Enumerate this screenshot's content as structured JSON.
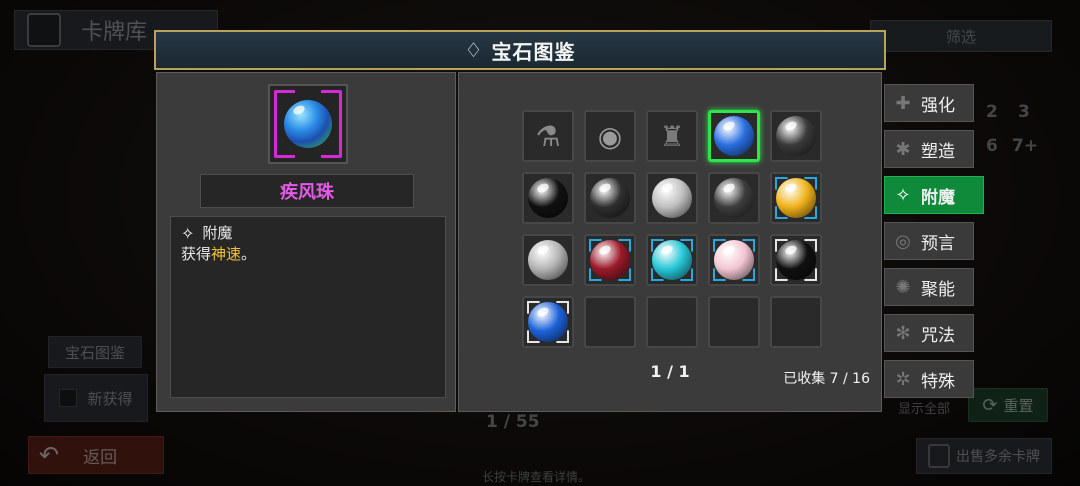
{
  "background": {
    "title": "卡牌库",
    "filter_label": "筛选",
    "side_button_gem": "宝石图鉴",
    "side_button_new": "新获得",
    "numbers": [
      "2",
      "3",
      "6",
      "7+"
    ],
    "page_count": "1 / 55",
    "show_all": "显示全部",
    "reset": "重置",
    "back": "返回",
    "hint": "长按卡牌查看详情。",
    "sell": "出售多余卡牌"
  },
  "modal": {
    "title": "宝石图鉴",
    "selected": {
      "name": "疾风珠",
      "category": "附魔",
      "desc_prefix": "获得",
      "desc_keyword": "神速",
      "desc_suffix": "。"
    },
    "grid": [
      {
        "kind": "flask",
        "frame": "none",
        "color": "#8a8a8a"
      },
      {
        "kind": "egg",
        "frame": "none",
        "color": "#9a9a9a"
      },
      {
        "kind": "armor",
        "frame": "none",
        "color": "#7a7a7a"
      },
      {
        "kind": "orb",
        "frame": "selected",
        "color": "#2a6fe0"
      },
      {
        "kind": "orb",
        "frame": "none",
        "color": "#3a3a3a"
      },
      {
        "kind": "orb",
        "frame": "none",
        "color": "#111111"
      },
      {
        "kind": "orb",
        "frame": "none",
        "color": "#2f2f2f"
      },
      {
        "kind": "orb",
        "frame": "none",
        "color": "#bfbfbf"
      },
      {
        "kind": "orb",
        "frame": "none",
        "color": "#3d3d3d"
      },
      {
        "kind": "orb",
        "frame": "rare",
        "color": "#f0b21a"
      },
      {
        "kind": "orb",
        "frame": "none",
        "color": "#b5b5b5"
      },
      {
        "kind": "orb",
        "frame": "rare",
        "color": "#9a1a2a"
      },
      {
        "kind": "orb",
        "frame": "rare",
        "color": "#27c7d6"
      },
      {
        "kind": "orb",
        "frame": "rare",
        "color": "#f2c6d2"
      },
      {
        "kind": "orb",
        "frame": "white",
        "color": "#101010"
      },
      {
        "kind": "orb",
        "frame": "white",
        "color": "#1d62d8"
      },
      {
        "kind": "empty"
      },
      {
        "kind": "empty"
      },
      {
        "kind": "empty"
      },
      {
        "kind": "empty"
      }
    ],
    "pager": "1 / 1",
    "collected": "已收集 7 / 16"
  },
  "tabs": [
    {
      "label": "强化",
      "icon": "shield-plus-icon",
      "active": false
    },
    {
      "label": "塑造",
      "icon": "gear-icon",
      "active": false
    },
    {
      "label": "附魔",
      "icon": "wing-icon",
      "active": true
    },
    {
      "label": "预言",
      "icon": "eye-icon",
      "active": false
    },
    {
      "label": "聚能",
      "icon": "burst-icon",
      "active": false
    },
    {
      "label": "咒法",
      "icon": "spiral-icon",
      "active": false
    },
    {
      "label": "特殊",
      "icon": "cog-icon",
      "active": false
    }
  ]
}
